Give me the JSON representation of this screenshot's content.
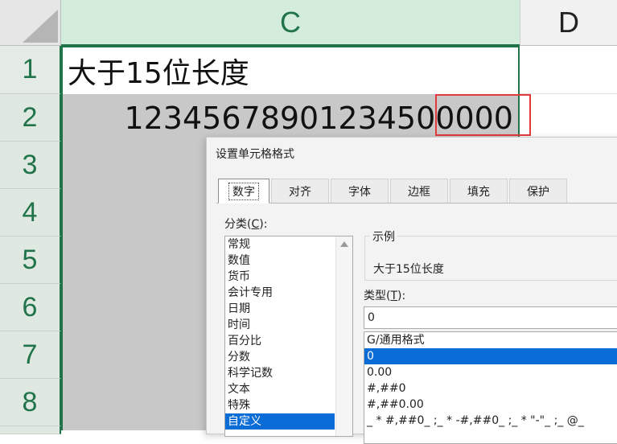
{
  "spreadsheet": {
    "columns": [
      "C",
      "D"
    ],
    "rows": [
      "1",
      "2",
      "3",
      "4",
      "5",
      "6",
      "7",
      "8"
    ],
    "cells": {
      "C1": "大于15位长度",
      "C2": "12345678901234500000"
    },
    "colors": {
      "header_accent": "#21744a",
      "highlight_box": "#e23a3a",
      "selection_fill": "#c8c8c8"
    }
  },
  "dialog": {
    "title": "设置单元格格式",
    "tabs": [
      "数字",
      "对齐",
      "字体",
      "边框",
      "填充",
      "保护"
    ],
    "active_tab": "数字",
    "category_label": "分类(C):",
    "categories": [
      "常规",
      "数值",
      "货币",
      "会计专用",
      "日期",
      "时间",
      "百分比",
      "分数",
      "科学记数",
      "文本",
      "特殊",
      "自定义"
    ],
    "selected_category": "自定义",
    "sample_label": "示例",
    "sample_value": "大于15位长度",
    "type_label": "类型(T):",
    "type_value": "0",
    "type_list": [
      "G/通用格式",
      "0",
      "0.00",
      "#,##0",
      "#,##0.00",
      "_ * #,##0_ ;_ * -#,##0_ ;_ * \"-\"_ ;_ @_"
    ],
    "selected_type": "0",
    "colors": {
      "selection": "#0a6cd6"
    }
  }
}
